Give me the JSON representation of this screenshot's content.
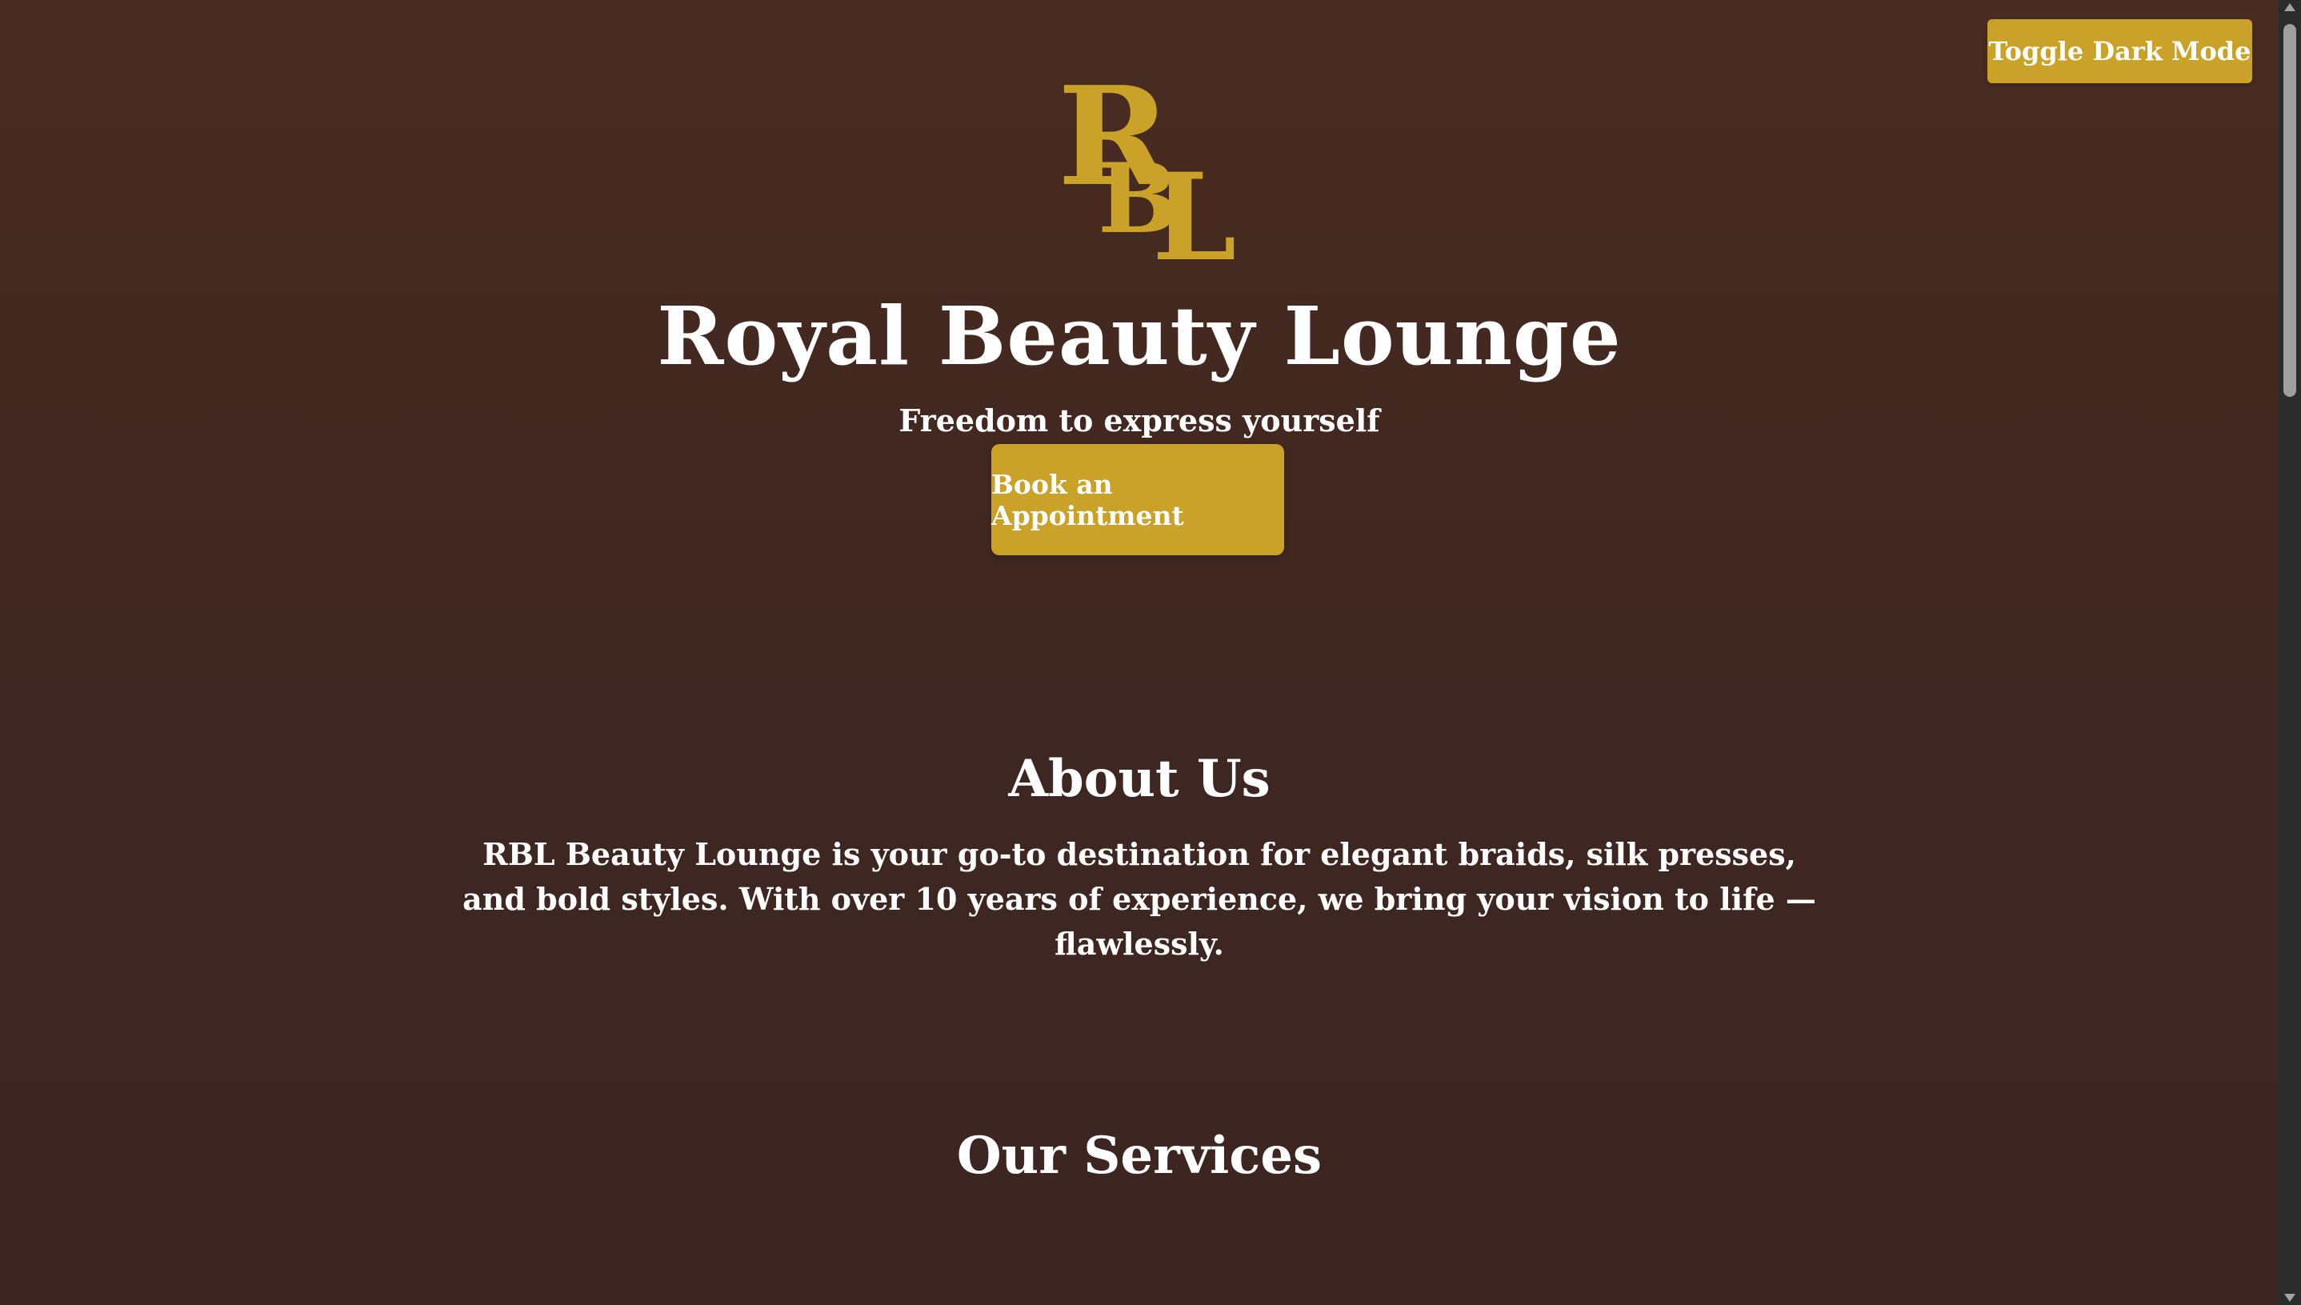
{
  "header": {
    "toggle_label": "Toggle Dark Mode",
    "logo_text": "RBL"
  },
  "hero": {
    "title": "Royal Beauty Lounge",
    "tagline": "Freedom to express yourself",
    "cta_label": "Book an Appointment"
  },
  "about": {
    "heading": "About Us",
    "text": "RBL Beauty Lounge is your go-to destination for elegant braids, silk presses, and bold styles. With over 10 years of experience, we bring your vision to life — flawlessly."
  },
  "services": {
    "heading": "Our Services"
  },
  "colors": {
    "accent": "#c9a227",
    "background_top": "#4a2c22",
    "background_bottom": "#3d2622",
    "text": "#ffffff"
  }
}
